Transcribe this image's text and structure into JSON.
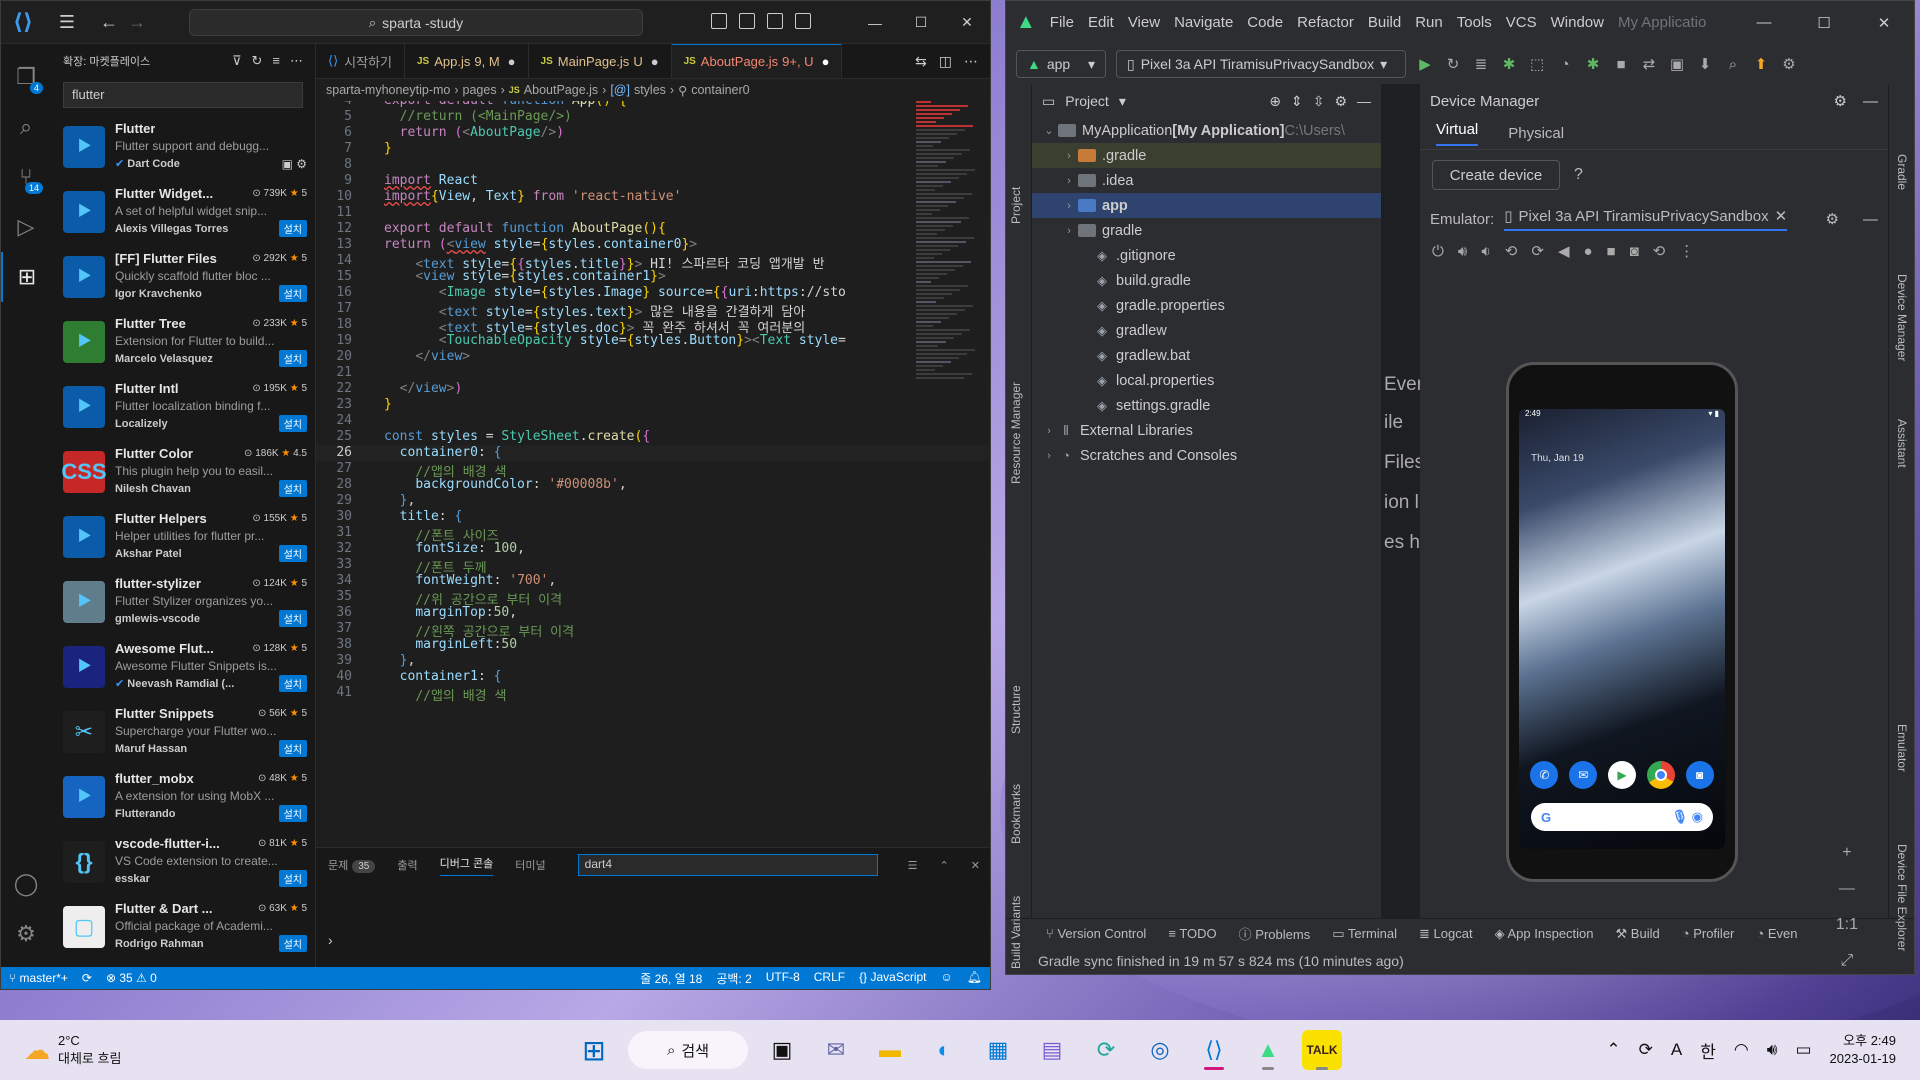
{
  "vscode": {
    "search": "sparta -study",
    "extensions_header": "확장: 마켓플레이스",
    "search_value": "flutter",
    "extensions": [
      {
        "name": "Flutter",
        "desc": "Flutter support and debugg...",
        "publisher": "Dart Code",
        "downloads": "",
        "rating": "",
        "installed": true
      },
      {
        "name": "Flutter Widget...",
        "desc": "A set of helpful widget snip...",
        "publisher": "Alexis Villegas Torres",
        "downloads": "739K",
        "rating": "5",
        "installed": false
      },
      {
        "name": "[FF] Flutter Files",
        "desc": "Quickly scaffold flutter bloc ...",
        "publisher": "Igor Kravchenko",
        "downloads": "292K",
        "rating": "5",
        "installed": false
      },
      {
        "name": "Flutter Tree",
        "desc": "Extension for Flutter to build...",
        "publisher": "Marcelo Velasquez",
        "downloads": "233K",
        "rating": "5",
        "installed": false
      },
      {
        "name": "Flutter Intl",
        "desc": "Flutter localization binding f...",
        "publisher": "Localizely",
        "downloads": "195K",
        "rating": "5",
        "installed": false
      },
      {
        "name": "Flutter Color",
        "desc": "This plugin help you to easil...",
        "publisher": "Nilesh Chavan",
        "downloads": "186K",
        "rating": "4.5",
        "installed": false
      },
      {
        "name": "Flutter Helpers",
        "desc": "Helper utilities for flutter pr...",
        "publisher": "Akshar Patel",
        "downloads": "155K",
        "rating": "5",
        "installed": false
      },
      {
        "name": "flutter-stylizer",
        "desc": "Flutter Stylizer organizes yo...",
        "publisher": "gmlewis-vscode",
        "downloads": "124K",
        "rating": "5",
        "installed": false
      },
      {
        "name": "Awesome Flut...",
        "desc": "Awesome Flutter Snippets is...",
        "publisher": "Neevash Ramdial (...",
        "downloads": "128K",
        "rating": "5",
        "installed": false
      },
      {
        "name": "Flutter Snippets",
        "desc": "Supercharge your Flutter wo...",
        "publisher": "Maruf Hassan",
        "downloads": "56K",
        "rating": "5",
        "installed": false
      },
      {
        "name": "flutter_mobx",
        "desc": "A extension for using MobX ...",
        "publisher": "Flutterando",
        "downloads": "48K",
        "rating": "5",
        "installed": false
      },
      {
        "name": "vscode-flutter-i...",
        "desc": "VS Code extension to create...",
        "publisher": "esskar",
        "downloads": "81K",
        "rating": "5",
        "installed": false
      },
      {
        "name": "Flutter & Dart ...",
        "desc": "Official package of Academi...",
        "publisher": "Rodrigo Rahman",
        "downloads": "63K",
        "rating": "5",
        "installed": false
      }
    ],
    "install_label": "설치",
    "tabs": [
      {
        "label": "시작하기",
        "type": "vs",
        "mod": ""
      },
      {
        "label": "App.js",
        "type": "js",
        "mod": "9, M"
      },
      {
        "label": "MainPage.js",
        "type": "js",
        "mod": "U"
      },
      {
        "label": "AboutPage.js",
        "type": "js",
        "mod": "9+, U"
      }
    ],
    "breadcrumb": [
      "sparta-myhoneytip-mo",
      "pages",
      "AboutPage.js",
      "styles",
      "container0"
    ],
    "panel": {
      "problems": "문제",
      "problems_count": "35",
      "output": "출력",
      "debug": "디버그 콘솔",
      "terminal": "터미널",
      "filter": "dart4"
    },
    "status": {
      "branch": "master*+",
      "errors": "35",
      "warnings": "0",
      "position": "줄 26, 열 18",
      "spaces": "공백: 2",
      "encoding": "UTF-8",
      "eol": "CRLF",
      "lang": "JavaScript"
    }
  },
  "studio": {
    "menu": [
      "File",
      "Edit",
      "View",
      "Navigate",
      "Code",
      "Refactor",
      "Build",
      "Run",
      "Tools",
      "VCS",
      "Window",
      "My Applicatio"
    ],
    "run_config": "app",
    "device": "Pixel 3a API TiramisuPrivacySandbox",
    "project_label": "Project",
    "tree": [
      {
        "label": "MyApplication",
        "bold": "[My Application]",
        "path": "C:\\Users\\",
        "indent": 0,
        "kind": "root"
      },
      {
        "label": ".gradle",
        "indent": 1,
        "kind": "orange"
      },
      {
        "label": ".idea",
        "indent": 1,
        "kind": "folder"
      },
      {
        "label": "app",
        "indent": 1,
        "kind": "blue"
      },
      {
        "label": "gradle",
        "indent": 1,
        "kind": "folder"
      },
      {
        "label": ".gitignore",
        "indent": 2,
        "kind": "file"
      },
      {
        "label": "build.gradle",
        "indent": 2,
        "kind": "file"
      },
      {
        "label": "gradle.properties",
        "indent": 2,
        "kind": "file"
      },
      {
        "label": "gradlew",
        "indent": 2,
        "kind": "file"
      },
      {
        "label": "gradlew.bat",
        "indent": 2,
        "kind": "file"
      },
      {
        "label": "local.properties",
        "indent": 2,
        "kind": "file"
      },
      {
        "label": "settings.gradle",
        "indent": 2,
        "kind": "file"
      },
      {
        "label": "External Libraries",
        "indent": 0,
        "kind": "lib"
      },
      {
        "label": "Scratches and Consoles",
        "indent": 0,
        "kind": "scratch"
      }
    ],
    "editor_fragments": [
      "Every",
      "ile",
      "Files",
      "ion l",
      "es h"
    ],
    "device_manager": "Device Manager",
    "dm_tabs": [
      "Virtual",
      "Physical"
    ],
    "create_device": "Create device",
    "emulator_label": "Emulator:",
    "emulator_tab": "Pixel 3a API TiramisuPrivacySandbox",
    "phone_time": "2:49",
    "phone_date": "Thu, Jan 19",
    "left_tools": [
      "Project",
      "Resource Manager",
      "Structure",
      "Bookmarks",
      "Build Variants"
    ],
    "right_tools": [
      "Gradle",
      "Device Manager",
      "Assistant",
      "Emulator",
      "Device File Explorer"
    ],
    "bottom_tools": [
      "Version Control",
      "TODO",
      "Problems",
      "Terminal",
      "Logcat",
      "App Inspection",
      "Build",
      "Profiler",
      "Even"
    ],
    "status": "Gradle sync finished in 19 m 57 s 824 ms (10 minutes ago)"
  },
  "taskbar": {
    "temp": "2°C",
    "weather": "대체로 흐림",
    "search": "검색",
    "time": "오후 2:49",
    "date": "2023-01-19",
    "ime": "한"
  }
}
